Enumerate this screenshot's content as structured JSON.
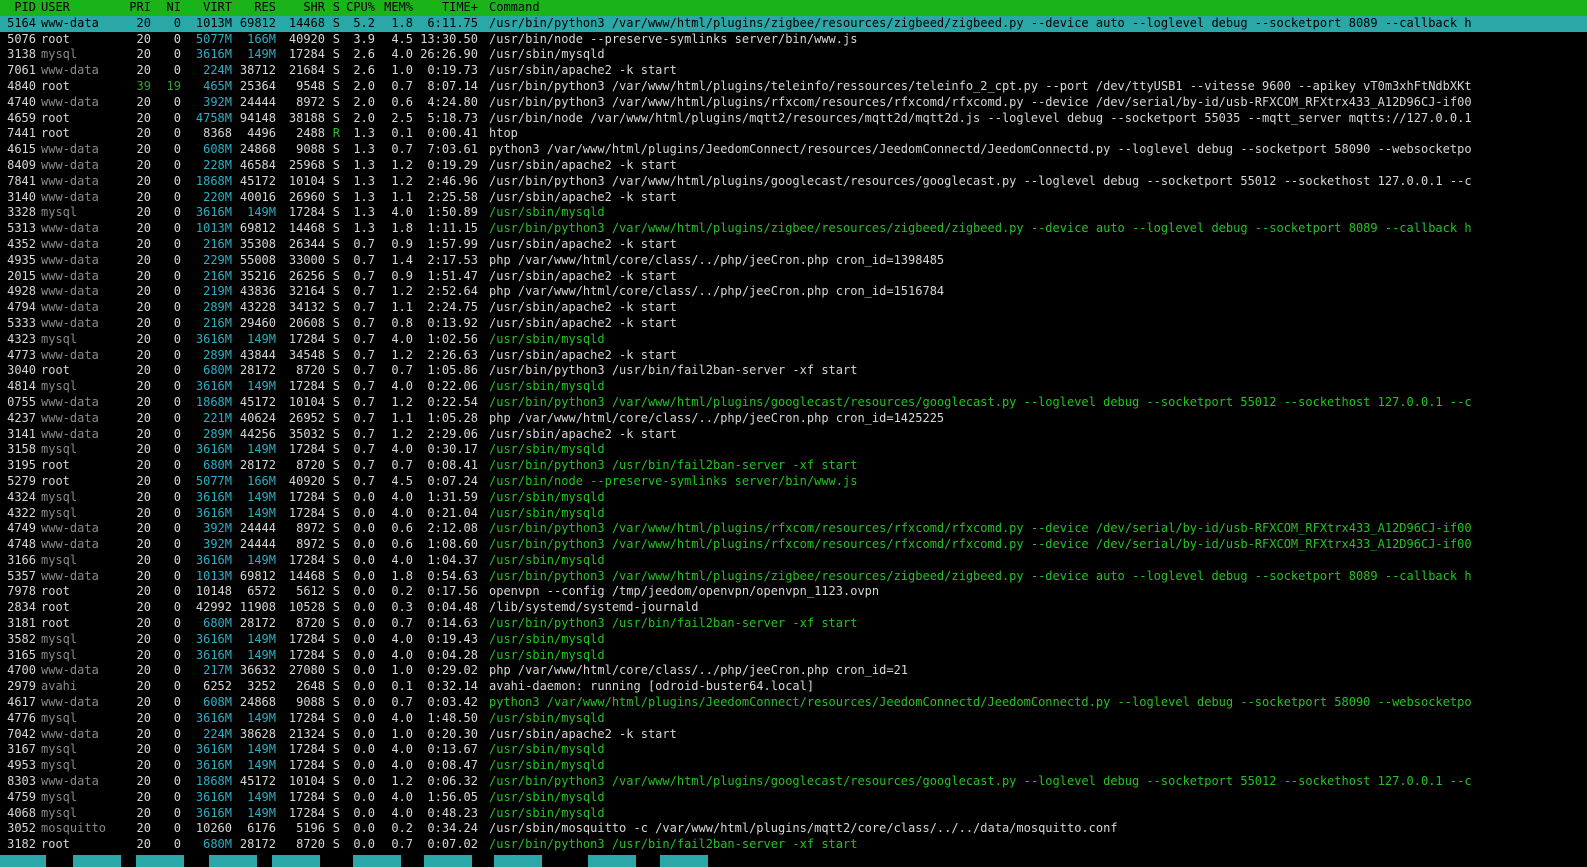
{
  "header": {
    "pid": "PID",
    "user": "USER",
    "pri": "PRI",
    "ni": "NI",
    "virt": "VIRT",
    "res": "RES",
    "shr": "SHR",
    "s": "S",
    "cpu": "CPU%",
    "mem": "MEM%",
    "time": "TIME+",
    "cmd": "Command"
  },
  "colors": {
    "header_bg": "#1ab31a",
    "selected_bg": "#2aa7a7",
    "thread_green": "#22c322",
    "mem_cyan": "#2bb0c4",
    "footer_key": "#2aa7a7"
  },
  "processes": [
    {
      "pid": "5164",
      "user": "www-data",
      "pri": "20",
      "ni": "0",
      "virt": "1013M",
      "res": "69812",
      "shr": "14468",
      "s": "S",
      "cpu": "5.2",
      "mem": "1.8",
      "time": "6:11.75",
      "cmd": "/usr/bin/python3 /var/www/html/plugins/zigbee/resources/zigbeed/zigbeed.py --device auto --loglevel debug --socketport 8089 --callback h",
      "selected": true,
      "thread": false
    },
    {
      "pid": "5076",
      "user": "root",
      "pri": "20",
      "ni": "0",
      "virt": "5077M",
      "res": "166M",
      "shr": "40920",
      "s": "S",
      "cpu": "3.9",
      "mem": "4.5",
      "time": "13:30.50",
      "cmd": "/usr/bin/node --preserve-symlinks server/bin/www.js",
      "thread": false
    },
    {
      "pid": "3138",
      "user": "mysql",
      "pri": "20",
      "ni": "0",
      "virt": "3616M",
      "res": "149M",
      "shr": "17284",
      "s": "S",
      "cpu": "2.6",
      "mem": "4.0",
      "time": "26:26.90",
      "cmd": "/usr/sbin/mysqld",
      "thread": false
    },
    {
      "pid": "7061",
      "user": "www-data",
      "pri": "20",
      "ni": "0",
      "virt": "224M",
      "res": "38712",
      "shr": "21684",
      "s": "S",
      "cpu": "2.6",
      "mem": "1.0",
      "time": "0:19.73",
      "cmd": "/usr/sbin/apache2 -k start",
      "thread": false
    },
    {
      "pid": "4840",
      "user": "root",
      "pri": "39",
      "ni": "19",
      "virt": "465M",
      "res": "25364",
      "shr": "9548",
      "s": "S",
      "cpu": "2.0",
      "mem": "0.7",
      "time": "8:07.14",
      "cmd": "/usr/bin/python3 /var/www/html/plugins/teleinfo/ressources/teleinfo_2_cpt.py --port /dev/ttyUSB1 --vitesse 9600 --apikey vT0m3xhFtNdbXKt",
      "thread": false,
      "nice": true
    },
    {
      "pid": "4740",
      "user": "www-data",
      "pri": "20",
      "ni": "0",
      "virt": "392M",
      "res": "24444",
      "shr": "8972",
      "s": "S",
      "cpu": "2.0",
      "mem": "0.6",
      "time": "4:24.80",
      "cmd": "/usr/bin/python3 /var/www/html/plugins/rfxcom/resources/rfxcomd/rfxcomd.py --device /dev/serial/by-id/usb-RFXCOM_RFXtrx433_A12D96CJ-if00",
      "thread": false
    },
    {
      "pid": "4659",
      "user": "root",
      "pri": "20",
      "ni": "0",
      "virt": "4758M",
      "res": "94148",
      "shr": "38188",
      "s": "S",
      "cpu": "2.0",
      "mem": "2.5",
      "time": "5:18.73",
      "cmd": "/usr/bin/node /var/www/html/plugins/mqtt2/resources/mqtt2d/mqtt2d.js --loglevel debug --socketport 55035 --mqtt_server mqtts://127.0.0.1",
      "thread": false
    },
    {
      "pid": "7441",
      "user": "root",
      "pri": "20",
      "ni": "0",
      "virt": "8368",
      "res": "4496",
      "shr": "2488",
      "s": "R",
      "cpu": "1.3",
      "mem": "0.1",
      "time": "0:00.41",
      "cmd": "htop",
      "thread": false,
      "running": true
    },
    {
      "pid": "4615",
      "user": "www-data",
      "pri": "20",
      "ni": "0",
      "virt": "608M",
      "res": "24868",
      "shr": "9088",
      "s": "S",
      "cpu": "1.3",
      "mem": "0.7",
      "time": "7:03.61",
      "cmd": "python3 /var/www/html/plugins/JeedomConnect/resources/JeedomConnectd/JeedomConnectd.py --loglevel debug --socketport 58090 --websocketpo",
      "thread": false
    },
    {
      "pid": "8409",
      "user": "www-data",
      "pri": "20",
      "ni": "0",
      "virt": "228M",
      "res": "46584",
      "shr": "25968",
      "s": "S",
      "cpu": "1.3",
      "mem": "1.2",
      "time": "0:19.29",
      "cmd": "/usr/sbin/apache2 -k start",
      "thread": false
    },
    {
      "pid": "7841",
      "user": "www-data",
      "pri": "20",
      "ni": "0",
      "virt": "1868M",
      "res": "45172",
      "shr": "10104",
      "s": "S",
      "cpu": "1.3",
      "mem": "1.2",
      "time": "2:46.96",
      "cmd": "/usr/bin/python3 /var/www/html/plugins/googlecast/resources/googlecast.py --loglevel debug --socketport 55012 --sockethost 127.0.0.1 --c",
      "thread": false
    },
    {
      "pid": "3140",
      "user": "www-data",
      "pri": "20",
      "ni": "0",
      "virt": "220M",
      "res": "40016",
      "shr": "26960",
      "s": "S",
      "cpu": "1.3",
      "mem": "1.1",
      "time": "2:25.58",
      "cmd": "/usr/sbin/apache2 -k start",
      "thread": false
    },
    {
      "pid": "3328",
      "user": "mysql",
      "pri": "20",
      "ni": "0",
      "virt": "3616M",
      "res": "149M",
      "shr": "17284",
      "s": "S",
      "cpu": "1.3",
      "mem": "4.0",
      "time": "1:50.89",
      "cmd": "/usr/sbin/mysqld",
      "thread": true
    },
    {
      "pid": "5313",
      "user": "www-data",
      "pri": "20",
      "ni": "0",
      "virt": "1013M",
      "res": "69812",
      "shr": "14468",
      "s": "S",
      "cpu": "1.3",
      "mem": "1.8",
      "time": "1:11.15",
      "cmd": "/usr/bin/python3 /var/www/html/plugins/zigbee/resources/zigbeed/zigbeed.py --device auto --loglevel debug --socketport 8089 --callback h",
      "thread": true
    },
    {
      "pid": "4352",
      "user": "www-data",
      "pri": "20",
      "ni": "0",
      "virt": "216M",
      "res": "35308",
      "shr": "26344",
      "s": "S",
      "cpu": "0.7",
      "mem": "0.9",
      "time": "1:57.99",
      "cmd": "/usr/sbin/apache2 -k start",
      "thread": false
    },
    {
      "pid": "4935",
      "user": "www-data",
      "pri": "20",
      "ni": "0",
      "virt": "229M",
      "res": "55008",
      "shr": "33000",
      "s": "S",
      "cpu": "0.7",
      "mem": "1.4",
      "time": "2:17.53",
      "cmd": "php /var/www/html/core/class/../php/jeeCron.php cron_id=1398485",
      "thread": false
    },
    {
      "pid": "2015",
      "user": "www-data",
      "pri": "20",
      "ni": "0",
      "virt": "216M",
      "res": "35216",
      "shr": "26256",
      "s": "S",
      "cpu": "0.7",
      "mem": "0.9",
      "time": "1:51.47",
      "cmd": "/usr/sbin/apache2 -k start",
      "thread": false
    },
    {
      "pid": "4928",
      "user": "www-data",
      "pri": "20",
      "ni": "0",
      "virt": "219M",
      "res": "43836",
      "shr": "32164",
      "s": "S",
      "cpu": "0.7",
      "mem": "1.2",
      "time": "2:52.64",
      "cmd": "php /var/www/html/core/class/../php/jeeCron.php cron_id=1516784",
      "thread": false
    },
    {
      "pid": "4794",
      "user": "www-data",
      "pri": "20",
      "ni": "0",
      "virt": "289M",
      "res": "43228",
      "shr": "34132",
      "s": "S",
      "cpu": "0.7",
      "mem": "1.1",
      "time": "2:24.75",
      "cmd": "/usr/sbin/apache2 -k start",
      "thread": false
    },
    {
      "pid": "5333",
      "user": "www-data",
      "pri": "20",
      "ni": "0",
      "virt": "216M",
      "res": "29460",
      "shr": "20608",
      "s": "S",
      "cpu": "0.7",
      "mem": "0.8",
      "time": "0:13.92",
      "cmd": "/usr/sbin/apache2 -k start",
      "thread": false
    },
    {
      "pid": "4323",
      "user": "mysql",
      "pri": "20",
      "ni": "0",
      "virt": "3616M",
      "res": "149M",
      "shr": "17284",
      "s": "S",
      "cpu": "0.7",
      "mem": "4.0",
      "time": "1:02.56",
      "cmd": "/usr/sbin/mysqld",
      "thread": true
    },
    {
      "pid": "4773",
      "user": "www-data",
      "pri": "20",
      "ni": "0",
      "virt": "289M",
      "res": "43844",
      "shr": "34548",
      "s": "S",
      "cpu": "0.7",
      "mem": "1.2",
      "time": "2:26.63",
      "cmd": "/usr/sbin/apache2 -k start",
      "thread": false
    },
    {
      "pid": "3040",
      "user": "root",
      "pri": "20",
      "ni": "0",
      "virt": "680M",
      "res": "28172",
      "shr": "8720",
      "s": "S",
      "cpu": "0.7",
      "mem": "0.7",
      "time": "1:05.86",
      "cmd": "/usr/bin/python3 /usr/bin/fail2ban-server -xf start",
      "thread": false
    },
    {
      "pid": "4814",
      "user": "mysql",
      "pri": "20",
      "ni": "0",
      "virt": "3616M",
      "res": "149M",
      "shr": "17284",
      "s": "S",
      "cpu": "0.7",
      "mem": "4.0",
      "time": "0:22.06",
      "cmd": "/usr/sbin/mysqld",
      "thread": true
    },
    {
      "pid": "0755",
      "user": "www-data",
      "pri": "20",
      "ni": "0",
      "virt": "1868M",
      "res": "45172",
      "shr": "10104",
      "s": "S",
      "cpu": "0.7",
      "mem": "1.2",
      "time": "0:22.54",
      "cmd": "/usr/bin/python3 /var/www/html/plugins/googlecast/resources/googlecast.py --loglevel debug --socketport 55012 --sockethost 127.0.0.1 --c",
      "thread": true
    },
    {
      "pid": "4237",
      "user": "www-data",
      "pri": "20",
      "ni": "0",
      "virt": "221M",
      "res": "40624",
      "shr": "26952",
      "s": "S",
      "cpu": "0.7",
      "mem": "1.1",
      "time": "1:05.28",
      "cmd": "php /var/www/html/core/class/../php/jeeCron.php cron_id=1425225",
      "thread": false
    },
    {
      "pid": "3141",
      "user": "www-data",
      "pri": "20",
      "ni": "0",
      "virt": "289M",
      "res": "44256",
      "shr": "35032",
      "s": "S",
      "cpu": "0.7",
      "mem": "1.2",
      "time": "2:29.06",
      "cmd": "/usr/sbin/apache2 -k start",
      "thread": false
    },
    {
      "pid": "3158",
      "user": "mysql",
      "pri": "20",
      "ni": "0",
      "virt": "3616M",
      "res": "149M",
      "shr": "17284",
      "s": "S",
      "cpu": "0.7",
      "mem": "4.0",
      "time": "0:30.17",
      "cmd": "/usr/sbin/mysqld",
      "thread": true
    },
    {
      "pid": "3195",
      "user": "root",
      "pri": "20",
      "ni": "0",
      "virt": "680M",
      "res": "28172",
      "shr": "8720",
      "s": "S",
      "cpu": "0.7",
      "mem": "0.7",
      "time": "0:08.41",
      "cmd": "/usr/bin/python3 /usr/bin/fail2ban-server -xf start",
      "thread": true
    },
    {
      "pid": "5279",
      "user": "root",
      "pri": "20",
      "ni": "0",
      "virt": "5077M",
      "res": "166M",
      "shr": "40920",
      "s": "S",
      "cpu": "0.7",
      "mem": "4.5",
      "time": "0:07.24",
      "cmd": "/usr/bin/node --preserve-symlinks server/bin/www.js",
      "thread": true
    },
    {
      "pid": "4324",
      "user": "mysql",
      "pri": "20",
      "ni": "0",
      "virt": "3616M",
      "res": "149M",
      "shr": "17284",
      "s": "S",
      "cpu": "0.0",
      "mem": "4.0",
      "time": "1:31.59",
      "cmd": "/usr/sbin/mysqld",
      "thread": true
    },
    {
      "pid": "4322",
      "user": "mysql",
      "pri": "20",
      "ni": "0",
      "virt": "3616M",
      "res": "149M",
      "shr": "17284",
      "s": "S",
      "cpu": "0.0",
      "mem": "4.0",
      "time": "0:21.04",
      "cmd": "/usr/sbin/mysqld",
      "thread": true
    },
    {
      "pid": "4749",
      "user": "www-data",
      "pri": "20",
      "ni": "0",
      "virt": "392M",
      "res": "24444",
      "shr": "8972",
      "s": "S",
      "cpu": "0.0",
      "mem": "0.6",
      "time": "2:12.08",
      "cmd": "/usr/bin/python3 /var/www/html/plugins/rfxcom/resources/rfxcomd/rfxcomd.py --device /dev/serial/by-id/usb-RFXCOM_RFXtrx433_A12D96CJ-if00",
      "thread": true
    },
    {
      "pid": "4748",
      "user": "www-data",
      "pri": "20",
      "ni": "0",
      "virt": "392M",
      "res": "24444",
      "shr": "8972",
      "s": "S",
      "cpu": "0.0",
      "mem": "0.6",
      "time": "1:08.60",
      "cmd": "/usr/bin/python3 /var/www/html/plugins/rfxcom/resources/rfxcomd/rfxcomd.py --device /dev/serial/by-id/usb-RFXCOM_RFXtrx433_A12D96CJ-if00",
      "thread": true
    },
    {
      "pid": "3166",
      "user": "mysql",
      "pri": "20",
      "ni": "0",
      "virt": "3616M",
      "res": "149M",
      "shr": "17284",
      "s": "S",
      "cpu": "0.0",
      "mem": "4.0",
      "time": "1:04.37",
      "cmd": "/usr/sbin/mysqld",
      "thread": true
    },
    {
      "pid": "5357",
      "user": "www-data",
      "pri": "20",
      "ni": "0",
      "virt": "1013M",
      "res": "69812",
      "shr": "14468",
      "s": "S",
      "cpu": "0.0",
      "mem": "1.8",
      "time": "0:54.63",
      "cmd": "/usr/bin/python3 /var/www/html/plugins/zigbee/resources/zigbeed/zigbeed.py --device auto --loglevel debug --socketport 8089 --callback h",
      "thread": true
    },
    {
      "pid": "7978",
      "user": "root",
      "pri": "20",
      "ni": "0",
      "virt": "10148",
      "res": "6572",
      "shr": "5612",
      "s": "S",
      "cpu": "0.0",
      "mem": "0.2",
      "time": "0:17.56",
      "cmd": "openvpn --config /tmp/jeedom/openvpn/openvpn_1123.ovpn",
      "thread": false
    },
    {
      "pid": "2834",
      "user": "root",
      "pri": "20",
      "ni": "0",
      "virt": "42992",
      "res": "11908",
      "shr": "10528",
      "s": "S",
      "cpu": "0.0",
      "mem": "0.3",
      "time": "0:04.48",
      "cmd": "/lib/systemd/systemd-journald",
      "thread": false
    },
    {
      "pid": "3181",
      "user": "root",
      "pri": "20",
      "ni": "0",
      "virt": "680M",
      "res": "28172",
      "shr": "8720",
      "s": "S",
      "cpu": "0.0",
      "mem": "0.7",
      "time": "0:14.63",
      "cmd": "/usr/bin/python3 /usr/bin/fail2ban-server -xf start",
      "thread": true
    },
    {
      "pid": "3582",
      "user": "mysql",
      "pri": "20",
      "ni": "0",
      "virt": "3616M",
      "res": "149M",
      "shr": "17284",
      "s": "S",
      "cpu": "0.0",
      "mem": "4.0",
      "time": "0:19.43",
      "cmd": "/usr/sbin/mysqld",
      "thread": true
    },
    {
      "pid": "3165",
      "user": "mysql",
      "pri": "20",
      "ni": "0",
      "virt": "3616M",
      "res": "149M",
      "shr": "17284",
      "s": "S",
      "cpu": "0.0",
      "mem": "4.0",
      "time": "0:04.28",
      "cmd": "/usr/sbin/mysqld",
      "thread": true
    },
    {
      "pid": "4700",
      "user": "www-data",
      "pri": "20",
      "ni": "0",
      "virt": "217M",
      "res": "36632",
      "shr": "27080",
      "s": "S",
      "cpu": "0.0",
      "mem": "1.0",
      "time": "0:29.02",
      "cmd": "php /var/www/html/core/class/../php/jeeCron.php cron_id=21",
      "thread": false
    },
    {
      "pid": "2979",
      "user": "avahi",
      "pri": "20",
      "ni": "0",
      "virt": "6252",
      "res": "3252",
      "shr": "2648",
      "s": "S",
      "cpu": "0.0",
      "mem": "0.1",
      "time": "0:32.14",
      "cmd": "avahi-daemon: running [odroid-buster64.local]",
      "thread": false
    },
    {
      "pid": "4617",
      "user": "www-data",
      "pri": "20",
      "ni": "0",
      "virt": "608M",
      "res": "24868",
      "shr": "9088",
      "s": "S",
      "cpu": "0.0",
      "mem": "0.7",
      "time": "0:03.42",
      "cmd": "python3 /var/www/html/plugins/JeedomConnect/resources/JeedomConnectd/JeedomConnectd.py --loglevel debug --socketport 58090 --websocketpo",
      "thread": true
    },
    {
      "pid": "4776",
      "user": "mysql",
      "pri": "20",
      "ni": "0",
      "virt": "3616M",
      "res": "149M",
      "shr": "17284",
      "s": "S",
      "cpu": "0.0",
      "mem": "4.0",
      "time": "1:48.50",
      "cmd": "/usr/sbin/mysqld",
      "thread": true
    },
    {
      "pid": "7042",
      "user": "www-data",
      "pri": "20",
      "ni": "0",
      "virt": "224M",
      "res": "38628",
      "shr": "21324",
      "s": "S",
      "cpu": "0.0",
      "mem": "1.0",
      "time": "0:20.30",
      "cmd": "/usr/sbin/apache2 -k start",
      "thread": false
    },
    {
      "pid": "3167",
      "user": "mysql",
      "pri": "20",
      "ni": "0",
      "virt": "3616M",
      "res": "149M",
      "shr": "17284",
      "s": "S",
      "cpu": "0.0",
      "mem": "4.0",
      "time": "0:13.67",
      "cmd": "/usr/sbin/mysqld",
      "thread": true
    },
    {
      "pid": "4953",
      "user": "mysql",
      "pri": "20",
      "ni": "0",
      "virt": "3616M",
      "res": "149M",
      "shr": "17284",
      "s": "S",
      "cpu": "0.0",
      "mem": "4.0",
      "time": "0:08.47",
      "cmd": "/usr/sbin/mysqld",
      "thread": true
    },
    {
      "pid": "8303",
      "user": "www-data",
      "pri": "20",
      "ni": "0",
      "virt": "1868M",
      "res": "45172",
      "shr": "10104",
      "s": "S",
      "cpu": "0.0",
      "mem": "1.2",
      "time": "0:06.32",
      "cmd": "/usr/bin/python3 /var/www/html/plugins/googlecast/resources/googlecast.py --loglevel debug --socketport 55012 --sockethost 127.0.0.1 --c",
      "thread": true
    },
    {
      "pid": "4759",
      "user": "mysql",
      "pri": "20",
      "ni": "0",
      "virt": "3616M",
      "res": "149M",
      "shr": "17284",
      "s": "S",
      "cpu": "0.0",
      "mem": "4.0",
      "time": "1:56.05",
      "cmd": "/usr/sbin/mysqld",
      "thread": true
    },
    {
      "pid": "4068",
      "user": "mysql",
      "pri": "20",
      "ni": "0",
      "virt": "3616M",
      "res": "149M",
      "shr": "17284",
      "s": "S",
      "cpu": "0.0",
      "mem": "4.0",
      "time": "0:48.23",
      "cmd": "/usr/sbin/mysqld",
      "thread": true
    },
    {
      "pid": "3052",
      "user": "mosquitto",
      "pri": "20",
      "ni": "0",
      "virt": "10260",
      "res": "6176",
      "shr": "5196",
      "s": "S",
      "cpu": "0.0",
      "mem": "0.2",
      "time": "0:34.24",
      "cmd": "/usr/sbin/mosquitto -c /var/www/html/plugins/mqtt2/core/class/../../data/mosquitto.conf",
      "thread": false
    },
    {
      "pid": "3182",
      "user": "root",
      "pri": "20",
      "ni": "0",
      "virt": "680M",
      "res": "28172",
      "shr": "8720",
      "s": "S",
      "cpu": "0.0",
      "mem": "0.7",
      "time": "0:07.02",
      "cmd": "/usr/bin/python3 /usr/bin/fail2ban-server -xf start",
      "thread": true
    }
  ]
}
